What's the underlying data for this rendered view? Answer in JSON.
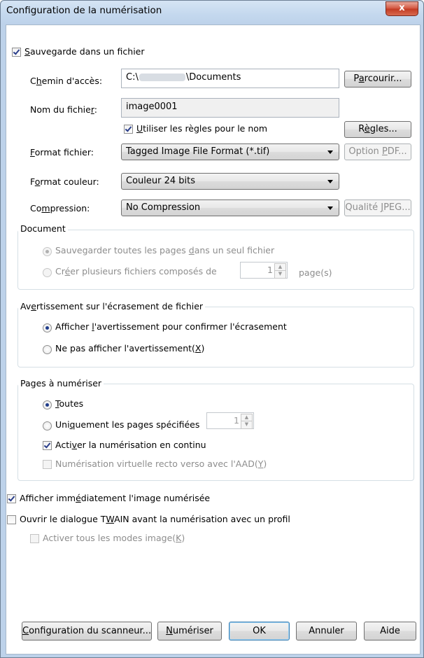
{
  "window": {
    "title": "Configuration de la numérisation",
    "close_symbol": "x"
  },
  "save_to_file": {
    "label_accel": "S",
    "label_rest": "auvegarde dans un fichier",
    "checked": true
  },
  "path": {
    "label_a": "C",
    "label_accel": "h",
    "label_b": "emin d'accès:",
    "value_prefix": "C:\\",
    "value_suffix": "\\Documents",
    "browse_a": "P",
    "browse_accel": "a",
    "browse_b": "rcourir..."
  },
  "filename": {
    "label_a": "Nom du fichie",
    "label_accel": "r",
    "label_b": ":",
    "value": "image0001"
  },
  "naming_rules": {
    "accel": "U",
    "rest": "tiliser les règles pour le nom",
    "checked": true,
    "button_a": "R",
    "button_accel": "è",
    "button_b": "gles..."
  },
  "file_format": {
    "label_accel": "F",
    "label_rest": "ormat fichier:",
    "value": "Tagged Image File Format (*.tif)",
    "pdf_a": "Option ",
    "pdf_accel": "P",
    "pdf_b": "DF..."
  },
  "color_format": {
    "label_a": "F",
    "label_accel": "o",
    "label_b": "rmat couleur:",
    "value": "Couleur 24 bits"
  },
  "compression": {
    "label_a": "Co",
    "label_accel": "m",
    "label_b": "pression:",
    "value": "No Compression",
    "jpeg_a": "Qualité ",
    "jpeg_accel": "J",
    "jpeg_b": "PEG..."
  },
  "document_group": {
    "title": "Document",
    "opt1_a": "Sauvegarder toutes les pages ",
    "opt1_accel": "d",
    "opt1_b": "ans un seul fichier",
    "opt2_a": "Cr",
    "opt2_accel": "é",
    "opt2_b": "er plusieurs fichiers composés de",
    "pages_value": "1",
    "pages_suffix": "page(s)"
  },
  "overwrite_group": {
    "title_a": "Av",
    "title_accel": "e",
    "title_b": "rtissement sur l'écrasement de fichier",
    "opt1_a": "Afficher ",
    "opt1_accel": "l",
    "opt1_b": "'avertissement pour confirmer l'écrasement",
    "opt2_a": "Ne pas afficher l'avertissement(",
    "opt2_accel": "X",
    "opt2_b": ")"
  },
  "pages_group": {
    "title": "Pages à numériser",
    "all_accel": "T",
    "all_rest": "outes",
    "specified_a": "Uni",
    "specified_accel": "q",
    "specified_b": "uement les pages spécifiées",
    "specified_value": "1",
    "continuous_a": "Acti",
    "continuous_accel": "v",
    "continuous_b": "er la numérisation en continu",
    "continuous_checked": true,
    "duplex_a": "Numérisation virtuelle recto verso avec l'AAD(",
    "duplex_accel": "Y",
    "duplex_b": ")"
  },
  "show_image": {
    "a": "Afficher imm",
    "accel": "é",
    "b": "diatement l'image numérisée",
    "checked": true
  },
  "twain_dialog": {
    "a": "Ouvrir le dialogue T",
    "accel": "W",
    "b": "AIN avant la numérisation avec un profil",
    "checked": false
  },
  "all_image_modes": {
    "a": "Activer tous les modes image(",
    "accel": "K",
    "b": ")"
  },
  "buttons": {
    "scanner_a": "",
    "scanner_accel": "C",
    "scanner_b": "onfiguration du scanneur...",
    "scan_accel": "N",
    "scan_b": "umériser",
    "ok": "OK",
    "cancel": "Annuler",
    "help": "Aide"
  }
}
